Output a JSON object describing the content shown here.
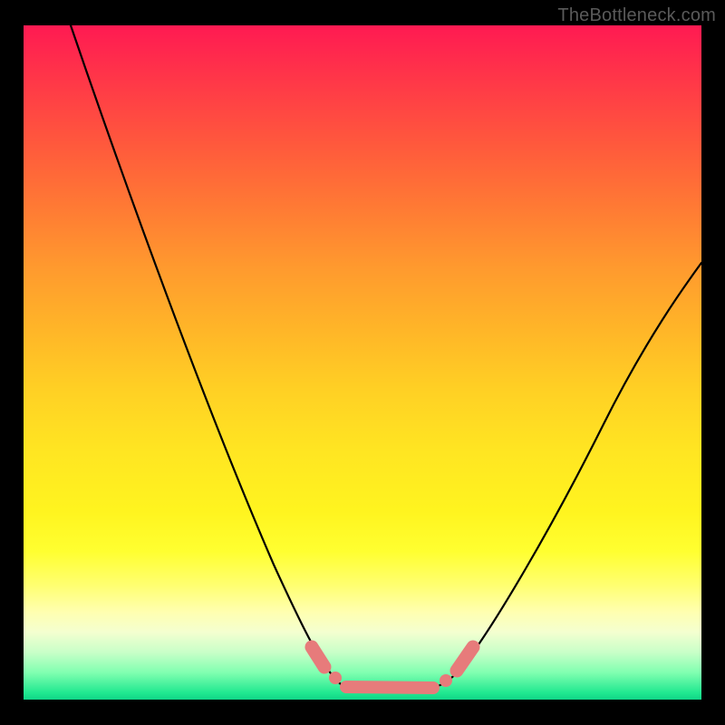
{
  "watermark": "TheBottleneck.com",
  "chart_data": {
    "type": "line",
    "title": "",
    "xlabel": "",
    "ylabel": "",
    "xlim": [
      0,
      100
    ],
    "ylim": [
      0,
      100
    ],
    "gradient_stops": [
      {
        "pct": 0,
        "color": "#ff1a52"
      },
      {
        "pct": 18,
        "color": "#ff5a3c"
      },
      {
        "pct": 45,
        "color": "#ffb528"
      },
      {
        "pct": 72,
        "color": "#fff41f"
      },
      {
        "pct": 87,
        "color": "#ffffb0"
      },
      {
        "pct": 96,
        "color": "#80ffb0"
      },
      {
        "pct": 100,
        "color": "#10d487"
      }
    ],
    "series": [
      {
        "name": "bottleneck-curve-left",
        "x": [
          7,
          12,
          18,
          24,
          30,
          36,
          40,
          44,
          46,
          48
        ],
        "values": [
          100,
          82,
          64,
          47,
          31,
          17,
          9,
          4,
          2.3,
          1.8
        ]
      },
      {
        "name": "bottleneck-curve-floor",
        "x": [
          48,
          52,
          56,
          60,
          63
        ],
        "values": [
          1.8,
          1.5,
          1.5,
          1.8,
          2.3
        ]
      },
      {
        "name": "bottleneck-curve-right",
        "x": [
          63,
          66,
          70,
          76,
          84,
          92,
          100
        ],
        "values": [
          2.3,
          4,
          8,
          17,
          31,
          46,
          62
        ]
      }
    ],
    "highlight_points": {
      "name": "highlighted-segment",
      "color": "#e77a7a",
      "x": [
        44,
        46,
        48,
        52,
        56,
        60,
        63,
        64,
        66
      ],
      "values": [
        4.0,
        2.3,
        1.8,
        1.5,
        1.5,
        1.8,
        2.3,
        3.0,
        4.5
      ]
    }
  }
}
